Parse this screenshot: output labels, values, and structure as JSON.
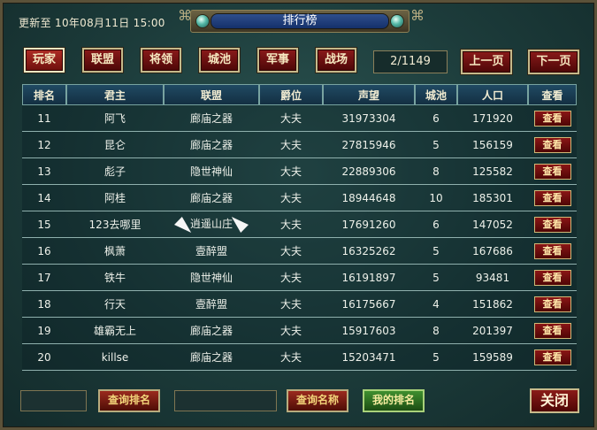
{
  "header": {
    "updated_text": "更新至 10年08月11日 15:00",
    "title": "排行榜"
  },
  "tabs": [
    {
      "label": "玩家",
      "active": true
    },
    {
      "label": "联盟",
      "active": false
    },
    {
      "label": "将领",
      "active": false
    },
    {
      "label": "城池",
      "active": false
    },
    {
      "label": "军事",
      "active": false
    },
    {
      "label": "战场",
      "active": false
    }
  ],
  "pager": {
    "page_text": "2/1149",
    "prev_label": "上一页",
    "next_label": "下一页"
  },
  "table": {
    "columns": [
      "排名",
      "君主",
      "联盟",
      "爵位",
      "声望",
      "城池",
      "人口",
      "查看"
    ],
    "rows": [
      {
        "rank": "11",
        "lord": "阿飞",
        "alliance": "廊庙之器",
        "title": "大夫",
        "prestige": "31973304",
        "cities": "6",
        "population": "171920",
        "view": "查看"
      },
      {
        "rank": "12",
        "lord": "昆仑",
        "alliance": "廊庙之器",
        "title": "大夫",
        "prestige": "27815946",
        "cities": "5",
        "population": "156159",
        "view": "查看"
      },
      {
        "rank": "13",
        "lord": "彪子",
        "alliance": "隐世神仙",
        "title": "大夫",
        "prestige": "22889306",
        "cities": "8",
        "population": "125582",
        "view": "查看"
      },
      {
        "rank": "14",
        "lord": "阿桂",
        "alliance": "廊庙之器",
        "title": "大夫",
        "prestige": "18944648",
        "cities": "10",
        "population": "185301",
        "view": "查看"
      },
      {
        "rank": "15",
        "lord": "123去哪里",
        "alliance": "逍遥山庄",
        "alliance_decorated": true,
        "title": "大夫",
        "prestige": "17691260",
        "cities": "6",
        "population": "147052",
        "view": "查看"
      },
      {
        "rank": "16",
        "lord": "枫萧",
        "alliance": "壹醉盟",
        "title": "大夫",
        "prestige": "16325262",
        "cities": "5",
        "population": "167686",
        "view": "查看"
      },
      {
        "rank": "17",
        "lord": "铁牛",
        "alliance": "隐世神仙",
        "title": "大夫",
        "prestige": "16191897",
        "cities": "5",
        "population": "93481",
        "view": "查看"
      },
      {
        "rank": "18",
        "lord": "行天",
        "alliance": "壹醉盟",
        "title": "大夫",
        "prestige": "16175667",
        "cities": "4",
        "population": "151862",
        "view": "查看"
      },
      {
        "rank": "19",
        "lord": "雄霸无上",
        "alliance": "廊庙之器",
        "title": "大夫",
        "prestige": "15917603",
        "cities": "8",
        "population": "201397",
        "view": "查看"
      },
      {
        "rank": "20",
        "lord": "killse",
        "alliance": "廊庙之器",
        "title": "大夫",
        "prestige": "15203471",
        "cities": "5",
        "population": "159589",
        "view": "查看"
      }
    ]
  },
  "footer": {
    "rank_query_value": "",
    "rank_query_label": "查询排名",
    "name_query_value": "",
    "name_query_label": "查询名称",
    "my_rank_label": "我的排名",
    "close_label": "关闭"
  },
  "colors": {
    "panel_bg": "#1c3b3a",
    "button_red": "#6d100c",
    "header_blue": "#14306a",
    "my_rank_green": "#3f8f2f"
  }
}
